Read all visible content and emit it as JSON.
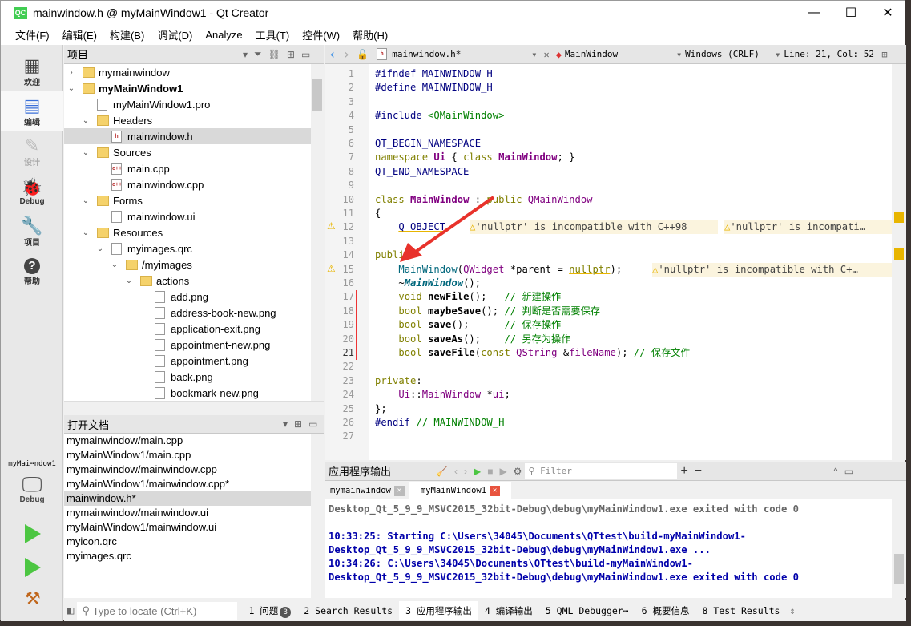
{
  "window": {
    "title": "mainwindow.h @ myMainWindow1 - Qt Creator",
    "app_icon": "QC"
  },
  "menu": [
    "文件(F)",
    "编辑(E)",
    "构建(B)",
    "调试(D)",
    "Analyze",
    "工具(T)",
    "控件(W)",
    "帮助(H)"
  ],
  "modes": [
    {
      "label": "欢迎",
      "icon": "grid-icon"
    },
    {
      "label": "编辑",
      "icon": "edit-icon"
    },
    {
      "label": "设计",
      "icon": "pencil-icon"
    },
    {
      "label": "Debug",
      "icon": "bug-icon"
    },
    {
      "label": "项目",
      "icon": "wrench-icon"
    },
    {
      "label": "帮助",
      "icon": "help-icon"
    }
  ],
  "kit": {
    "name": "myMai⋯ndow1",
    "config": "Debug"
  },
  "project_panel": {
    "title": "项目"
  },
  "tree": [
    {
      "label": "mymainwindow",
      "level": 0,
      "arrow": "collapsed",
      "icon": "project"
    },
    {
      "label": "myMainWindow1",
      "level": 0,
      "arrow": "expanded",
      "icon": "project",
      "bold": true
    },
    {
      "label": "myMainWindow1.pro",
      "level": 1,
      "icon": "pro"
    },
    {
      "label": "Headers",
      "level": 1,
      "arrow": "expanded",
      "icon": "h-folder"
    },
    {
      "label": "mainwindow.h",
      "level": 2,
      "icon": "h",
      "selected": true
    },
    {
      "label": "Sources",
      "level": 1,
      "arrow": "expanded",
      "icon": "cpp-folder"
    },
    {
      "label": "main.cpp",
      "level": 2,
      "icon": "cpp"
    },
    {
      "label": "mainwindow.cpp",
      "level": 2,
      "icon": "cpp"
    },
    {
      "label": "Forms",
      "level": 1,
      "arrow": "expanded",
      "icon": "ui-folder"
    },
    {
      "label": "mainwindow.ui",
      "level": 2,
      "icon": "ui"
    },
    {
      "label": "Resources",
      "level": 1,
      "arrow": "expanded",
      "icon": "res-folder"
    },
    {
      "label": "myimages.qrc",
      "level": 2,
      "arrow": "expanded",
      "icon": "qrc"
    },
    {
      "label": "/myimages",
      "level": 3,
      "arrow": "expanded",
      "icon": "folder"
    },
    {
      "label": "actions",
      "level": 4,
      "arrow": "expanded",
      "icon": "folder"
    },
    {
      "label": "add.png",
      "level": 5,
      "icon": "png"
    },
    {
      "label": "address-book-new.png",
      "level": 5,
      "icon": "png"
    },
    {
      "label": "application-exit.png",
      "level": 5,
      "icon": "png"
    },
    {
      "label": "appointment-new.png",
      "level": 5,
      "icon": "png"
    },
    {
      "label": "appointment.png",
      "level": 5,
      "icon": "png"
    },
    {
      "label": "back.png",
      "level": 5,
      "icon": "png"
    },
    {
      "label": "bookmark-new.png",
      "level": 5,
      "icon": "png"
    }
  ],
  "open_docs": {
    "title": "打开文档",
    "items": [
      {
        "label": "mymainwindow/main.cpp"
      },
      {
        "label": "myMainWindow1/main.cpp"
      },
      {
        "label": "mymainwindow/mainwindow.cpp"
      },
      {
        "label": "myMainWindow1/mainwindow.cpp*"
      },
      {
        "label": "mainwindow.h*",
        "selected": true
      },
      {
        "label": "mymainwindow/mainwindow.ui"
      },
      {
        "label": "myMainWindow1/mainwindow.ui"
      },
      {
        "label": "myicon.qrc"
      },
      {
        "label": "myimages.qrc"
      }
    ]
  },
  "editor_toolbar": {
    "file": "mainwindow.h*",
    "symbol": "MainWindow",
    "encoding": "Windows (CRLF)",
    "position": "Line: 21, Col: 52"
  },
  "code": [
    [
      [
        "#ifndef MAINWINDOW_H",
        "pp"
      ]
    ],
    [
      [
        "#define MAINWINDOW_H",
        "pp"
      ]
    ],
    [],
    [
      [
        "#include ",
        "pp"
      ],
      [
        "<QMainWindow>",
        "str"
      ]
    ],
    [],
    [
      [
        "QT_BEGIN_NAMESPACE",
        "mac"
      ]
    ],
    [
      [
        "namespace ",
        "kw"
      ],
      [
        "Ui",
        "ty b"
      ],
      [
        " { ",
        ""
      ],
      [
        "class ",
        "kw"
      ],
      [
        "MainWindow",
        "ty b"
      ],
      [
        "; }",
        ""
      ]
    ],
    [
      [
        "QT_END_NAMESPACE",
        "mac"
      ]
    ],
    [],
    [
      [
        "class ",
        "kw"
      ],
      [
        "MainWindow",
        "ty b"
      ],
      [
        " : ",
        ""
      ],
      [
        "public ",
        "kw"
      ],
      [
        "QMainWindow",
        "ty"
      ]
    ],
    [
      [
        "{",
        ""
      ]
    ],
    [
      [
        "    ",
        ""
      ],
      [
        "Q_OBJECT",
        "mac ul"
      ]
    ],
    [],
    [
      [
        "public",
        "kw"
      ],
      [
        ":",
        ""
      ]
    ],
    [
      [
        "    ",
        ""
      ],
      [
        "MainWindow",
        "fn"
      ],
      [
        "(",
        ""
      ],
      [
        "QWidget",
        "ty"
      ],
      [
        " *parent = ",
        ""
      ],
      [
        "nullptr",
        "kw ul"
      ],
      [
        ");",
        ""
      ]
    ],
    [
      [
        "    ~",
        ""
      ],
      [
        "MainWindow",
        "it"
      ],
      [
        "();",
        ""
      ]
    ],
    [
      [
        "    ",
        ""
      ],
      [
        "void ",
        "kw"
      ],
      [
        "newFile",
        "b"
      ],
      [
        "();   ",
        ""
      ],
      [
        "// 新建操作",
        "cm"
      ]
    ],
    [
      [
        "    ",
        ""
      ],
      [
        "bool ",
        "kw"
      ],
      [
        "maybeSave",
        "b"
      ],
      [
        "(); ",
        ""
      ],
      [
        "// 判断是否需要保存",
        "cm"
      ]
    ],
    [
      [
        "    ",
        ""
      ],
      [
        "bool ",
        "kw"
      ],
      [
        "save",
        "b"
      ],
      [
        "();      ",
        ""
      ],
      [
        "// 保存操作",
        "cm"
      ]
    ],
    [
      [
        "    ",
        ""
      ],
      [
        "bool ",
        "kw"
      ],
      [
        "saveAs",
        "b"
      ],
      [
        "();    ",
        ""
      ],
      [
        "// 另存为操作",
        "cm"
      ]
    ],
    [
      [
        "    ",
        ""
      ],
      [
        "bool ",
        "kw"
      ],
      [
        "saveFile",
        "b"
      ],
      [
        "(",
        ""
      ],
      [
        "const ",
        "kw"
      ],
      [
        "QString",
        "ty"
      ],
      [
        " &",
        ""
      ],
      [
        "fileName",
        "ty"
      ],
      [
        "); ",
        ""
      ],
      [
        "// 保存文件",
        "cm"
      ]
    ],
    [],
    [
      [
        "private",
        "kw"
      ],
      [
        ":",
        ""
      ]
    ],
    [
      [
        "    ",
        ""
      ],
      [
        "Ui",
        "ty"
      ],
      [
        "::",
        ""
      ],
      [
        "MainWindow",
        "ty"
      ],
      [
        " *",
        ""
      ],
      [
        "ui",
        "ty"
      ],
      [
        ";",
        ""
      ]
    ],
    [
      [
        "};",
        ""
      ]
    ],
    [
      [
        "#endif ",
        "pp"
      ],
      [
        "// MAINWINDOW_H",
        "cm"
      ]
    ],
    []
  ],
  "warnings": {
    "line12a": "'nullptr' is incompatible with C++98",
    "line12b": "'nullptr' is incompati…",
    "line15": "'nullptr' is incompatible with C+…"
  },
  "output_pane": {
    "title": "应用程序输出",
    "filter_placeholder": "Filter",
    "tabs": [
      {
        "label": "mymainwindow"
      },
      {
        "label": "myMainWindow1",
        "active": true
      }
    ],
    "lines": [
      {
        "text": "Desktop_Qt_5_9_9_MSVC2015_32bit-Debug\\debug\\myMainWindow1.exe exited with code 0",
        "gray": true
      },
      {
        "text": ""
      },
      {
        "text": "10:33:25: Starting C:\\Users\\34045\\Documents\\QTtest\\build-myMainWindow1-"
      },
      {
        "text": "Desktop_Qt_5_9_9_MSVC2015_32bit-Debug\\debug\\myMainWindow1.exe ..."
      },
      {
        "text": "10:34:26: C:\\Users\\34045\\Documents\\QTtest\\build-myMainWindow1-"
      },
      {
        "text": "Desktop_Qt_5_9_9_MSVC2015_32bit-Debug\\debug\\myMainWindow1.exe exited with code 0"
      }
    ]
  },
  "statusbar": {
    "locate_placeholder": "Type to locate (Ctrl+K)",
    "issues_count": "3",
    "panes": [
      "1 问题",
      "2 Search Results",
      "3 应用程序输出",
      "4 编译输出",
      "5 QML Debugger⋯",
      "6 概要信息",
      "8 Test Results"
    ]
  },
  "colors": {
    "accent_green": "#41cd52",
    "warning": "#e8b500",
    "output_blue": "#0000aa",
    "arrow_red": "#e8322b"
  }
}
